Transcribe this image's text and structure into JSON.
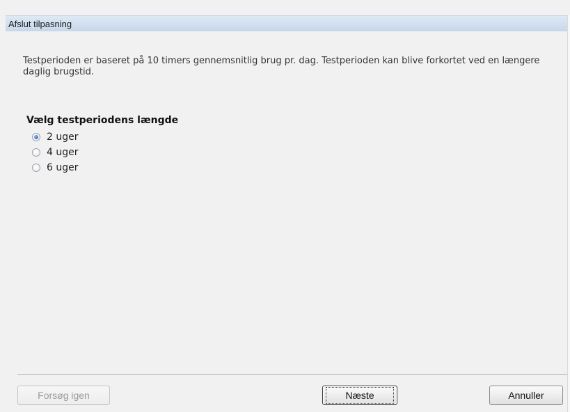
{
  "window": {
    "title": "Afslut tilpasning"
  },
  "intro_text": "Testperioden er baseret på 10  timers gennemsnitlig brug pr. dag. Testperioden kan blive forkortet ved en længere daglig brugstid.",
  "period": {
    "heading": "Vælg testperiodens længde",
    "options": [
      {
        "label": "2 uger",
        "selected": true
      },
      {
        "label": "4 uger",
        "selected": false
      },
      {
        "label": "6 uger",
        "selected": false
      }
    ]
  },
  "buttons": {
    "retry": "Forsøg igen",
    "next": "Næste",
    "cancel": "Annuller"
  }
}
